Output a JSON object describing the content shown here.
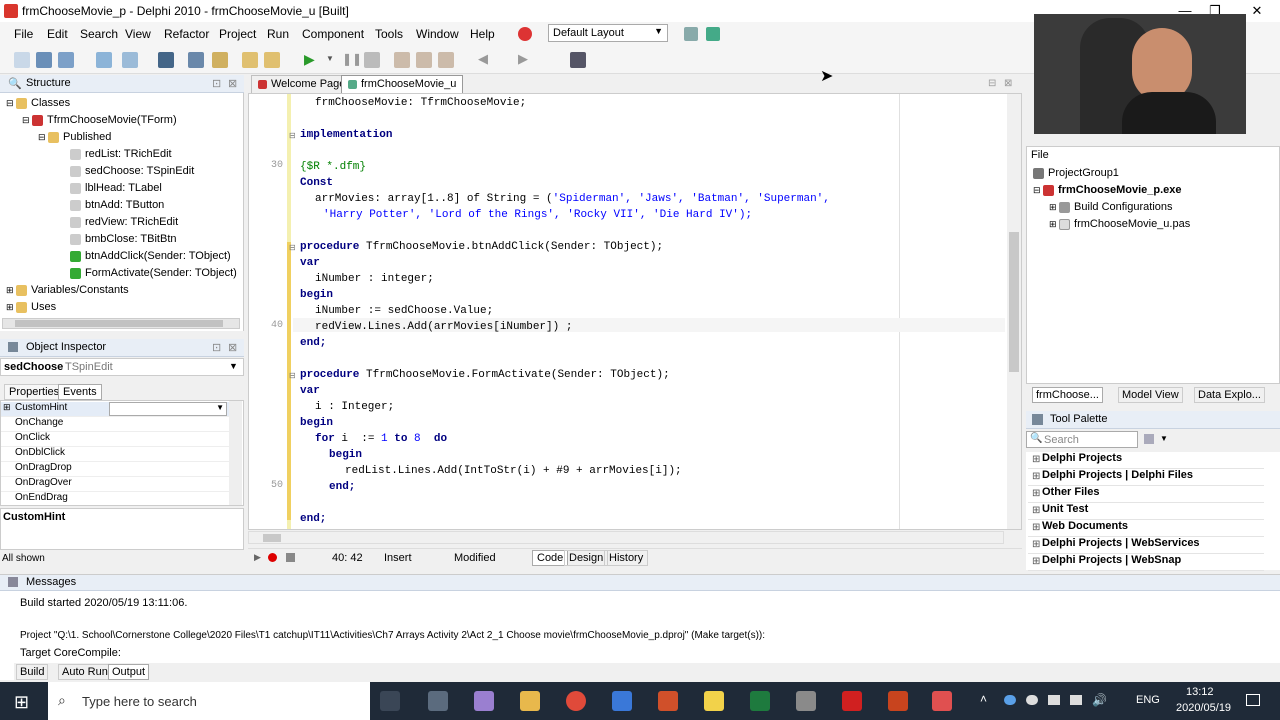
{
  "window": {
    "title": "frmChooseMovie_p - Delphi 2010 - frmChooseMovie_u [Built]",
    "minimize": "—",
    "maximize": "❐",
    "close": "✕"
  },
  "menu": [
    "File",
    "Edit",
    "Search",
    "View",
    "Refactor",
    "Project",
    "Run",
    "Component",
    "Tools",
    "Window",
    "Help"
  ],
  "layout_select": "Default Layout",
  "structure": {
    "title": "Structure",
    "items": [
      "Classes",
      "TfrmChooseMovie(TForm)",
      "Published",
      "redList: TRichEdit",
      "sedChoose: TSpinEdit",
      "lblHead: TLabel",
      "btnAdd: TButton",
      "redView: TRichEdit",
      "bmbClose: TBitBtn",
      "btnAddClick(Sender: TObject)",
      "FormActivate(Sender: TObject)",
      "Variables/Constants",
      "Uses"
    ]
  },
  "inspector": {
    "title": "Object Inspector",
    "object_name": "sedChoose",
    "object_type": "TSpinEdit",
    "tab_properties": "Properties",
    "tab_events": "Events",
    "rows": [
      "CustomHint",
      "OnChange",
      "OnClick",
      "OnDblClick",
      "OnDragDrop",
      "OnDragOver",
      "OnEndDrag"
    ],
    "selected_label": "CustomHint",
    "status": "All shown"
  },
  "editor": {
    "tab_welcome": "Welcome Page",
    "tab_active": "frmChooseMovie_u",
    "line_numbers": [
      "30",
      "40",
      "50"
    ],
    "status_pos": "40: 42",
    "status_mode": "Insert",
    "status_modified": "Modified",
    "bottom_tab_code": "Code",
    "bottom_tab_design": "Design",
    "bottom_tab_history": "History"
  },
  "code": {
    "l1": "frmChooseMovie: TfrmChooseMovie;",
    "l2": "implementation",
    "l3": "{$R *.dfm}",
    "l4": "Const",
    "l5a": "arrMovies: array[1..8] of String = (",
    "l5s": "'Spiderman', 'Jaws', 'Batman', 'Superman',",
    "l6": "'Harry Potter', 'Lord of the Rings', 'Rocky VII', 'Die Hard IV');",
    "l7a": "procedure",
    "l7b": " TfrmChooseMovie.btnAddClick(Sender: TObject);",
    "l8": "var",
    "l9": "iNumber : integer;",
    "l10": "begin",
    "l11": "iNumber := sedChoose.Value;",
    "l12": "redView.Lines.Add(arrMovies[iNumber]) ;",
    "l13": "end;",
    "l14a": "procedure",
    "l14b": " TfrmChooseMovie.FormActivate(Sender: TObject);",
    "l15": "var",
    "l16": "i : Integer;",
    "l17": "begin",
    "l18a": "for",
    "l18b": " i  := ",
    "l18c": "1",
    "l18d": " to ",
    "l18e": "8",
    "l18f": "  do",
    "l19": "begin",
    "l20": "redList.Lines.Add(IntToStr(i) + #9 + arrMovies[i]);",
    "l21": "end;",
    "l22": "end;"
  },
  "project": {
    "file_label": "File",
    "group": "ProjectGroup1",
    "exe": "frmChooseMovie_p.exe",
    "build_configs": "Build Configurations",
    "unit": "frmChooseMovie_u.pas",
    "tab1": "frmChoose...",
    "tab2": "Model View",
    "tab3": "Data Explo..."
  },
  "palette": {
    "title": "Tool Palette",
    "search_placeholder": "Search",
    "items": [
      "Delphi Projects",
      "Delphi Projects | Delphi Files",
      "Other Files",
      "Unit Test",
      "Web Documents",
      "Delphi Projects | WebServices",
      "Delphi Projects | WebSnap"
    ]
  },
  "messages": {
    "title": "Messages",
    "line1": "Build started 2020/05/19 13:11:06.",
    "line2": "Project \"Q:\\1. School\\Cornerstone College\\2020 Files\\T1 catchup\\IT11\\Activities\\Ch7 Arrays Activity 2\\Act 2_1 Choose movie\\frmChooseMovie_p.dproj\" (Make target(s)):",
    "line3": "Target CoreCompile:",
    "tab_build": "Build",
    "tab_autorun": "Auto Run",
    "tab_output": "Output"
  },
  "taskbar": {
    "search": "Type here to search",
    "lang": "ENG",
    "time": "13:12",
    "date": "2020/05/19"
  }
}
